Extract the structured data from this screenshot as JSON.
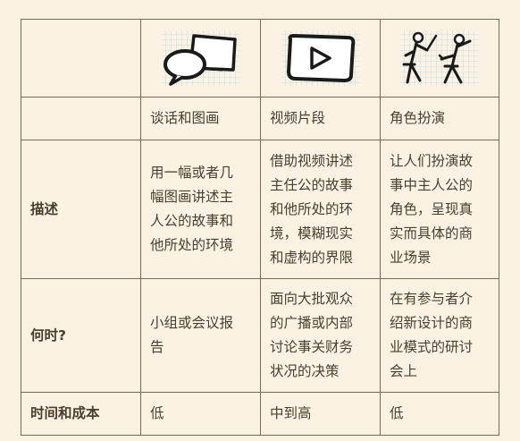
{
  "header": {
    "methods": [
      {
        "name": "谈话和图画",
        "icon": "speech-bubble-and-picture-icon"
      },
      {
        "name": "视频片段",
        "icon": "video-play-icon"
      },
      {
        "name": "角色扮演",
        "icon": "role-play-people-icon"
      }
    ]
  },
  "rows": [
    {
      "label": "描述",
      "cells": [
        [
          "用一幅或者几",
          "幅图画讲述主",
          "人公的故事和",
          "他所处的环境"
        ],
        [
          "借助视频讲述",
          "主任公的故事",
          "和他所处的环",
          "境，模糊现实",
          "和虚构的界限"
        ],
        [
          "让人们扮演故",
          "事中主人公的",
          "角色，呈现真",
          "实而具体的商",
          "业场景"
        ]
      ]
    },
    {
      "label": "何时?",
      "cells": [
        [
          "小组或会议报",
          "告"
        ],
        [
          "面向大批观众",
          "的广播或内部",
          "讨论事关财务",
          "状况的决策"
        ],
        [
          "在有参与者介",
          "绍新设计的商",
          "业模式的研讨",
          "会上"
        ]
      ]
    },
    {
      "label": "时间和成本",
      "cells": [
        [
          "低"
        ],
        [
          "中到高"
        ],
        [
          "低"
        ]
      ]
    }
  ],
  "colors": {
    "background": "#fbf2e3",
    "border": "#7a6a55",
    "method_name": "#4f9bc7",
    "text": "#4a3e30"
  }
}
